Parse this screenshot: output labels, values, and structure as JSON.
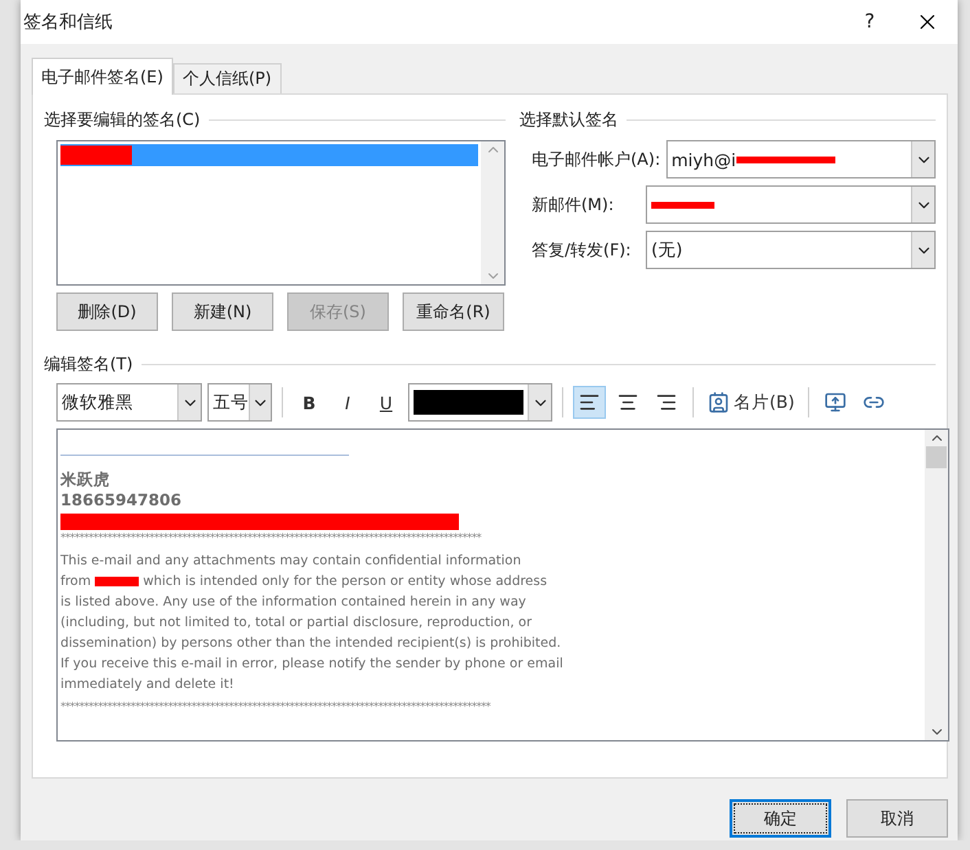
{
  "window": {
    "title": "签名和信纸",
    "help": "?"
  },
  "tabs": [
    {
      "label": "电子邮件签名(E)",
      "selected": true
    },
    {
      "label": "个人信纸(P)",
      "selected": false
    }
  ],
  "signature_list": {
    "heading": "选择要编辑的签名(C)",
    "items": [
      {
        "selected": true,
        "redacted": true
      }
    ]
  },
  "list_buttons": [
    {
      "label": "删除(D)",
      "disabled": false
    },
    {
      "label": "新建(N)",
      "disabled": false
    },
    {
      "label": "保存(S)",
      "disabled": true
    },
    {
      "label": "重命名(R)",
      "disabled": false
    }
  ],
  "defaults": {
    "heading": "选择默认签名",
    "fields": [
      {
        "label": "电子邮件帐户(A):",
        "value": "miyh@i",
        "redacted": true
      },
      {
        "label": "新邮件(M):",
        "redacted": true
      },
      {
        "label": "答复/转发(F):",
        "value": "(无)"
      }
    ]
  },
  "editor": {
    "heading": "编辑签名(T)",
    "font": "微软雅黑",
    "size": "五号",
    "bold": "B",
    "italic": "I",
    "underline": "U",
    "color": "#000000",
    "align": [
      {
        "kind": "left",
        "selected": true
      },
      {
        "kind": "center",
        "selected": false
      },
      {
        "kind": "right",
        "selected": false
      }
    ],
    "card": "名片(B)",
    "content": {
      "name": "米跃虎",
      "phone": "18665947806",
      "separator": "******************************************************************************************",
      "lines": [
        {
          "text": "This e-mail and any attachments may contain confidential information"
        },
        {
          "text": "from",
          "redacted": true,
          "rest": "which is intended only for the person or entity whose address"
        },
        {
          "text": "is listed above. Any use of the information contained herein in any way"
        },
        {
          "text": "(including, but not limited to, total or partial disclosure, reproduction, or"
        },
        {
          "text": "dissemination) by persons other than the intended recipient(s) is prohibited."
        },
        {
          "text": "If you receive this e-mail in error, please notify the sender by phone or email"
        },
        {
          "text": "immediately and delete it!"
        }
      ],
      "separator_end": "********************************************************************************************"
    }
  },
  "buttons": [
    {
      "label": "确定",
      "focused": true
    },
    {
      "label": "取消",
      "focused": false
    }
  ]
}
